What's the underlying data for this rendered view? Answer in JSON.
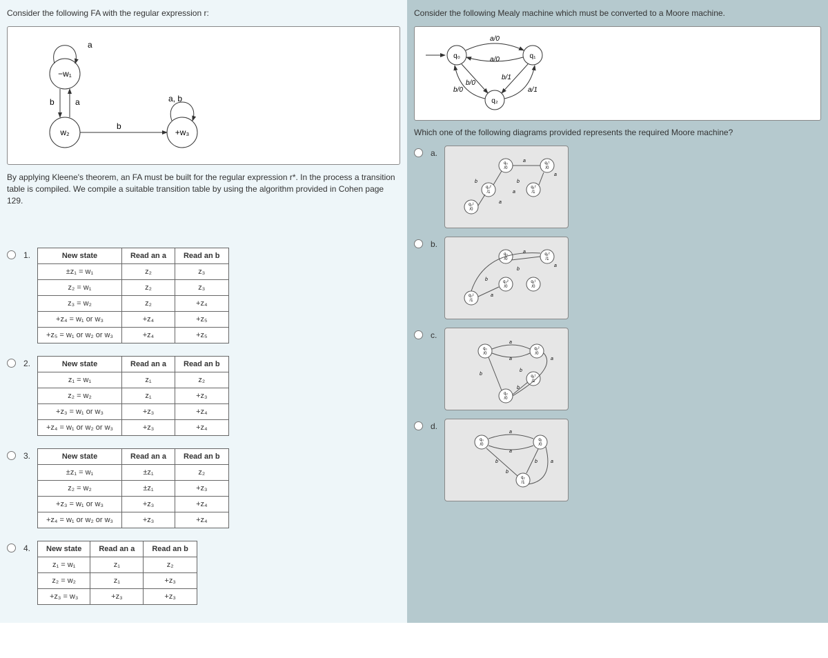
{
  "left": {
    "title": "Consider the following FA with the regular expression r:",
    "fa": {
      "w1": "−w₁",
      "w2": "w₂",
      "w3": "+w₃",
      "a": "a",
      "b": "b",
      "ab": "a, b"
    },
    "body": "By applying Kleene's theorem, an FA must be built for the regular expression r*. In the process a transition table is compiled. We compile a suitable transition table by using the algorithm provided in Cohen page 129.",
    "headers": {
      "c0": "New state",
      "c1": "Read an a",
      "c2": "Read an b"
    },
    "opts": {
      "1": [
        [
          "±z₁ = w₁",
          "z₂",
          "z₃"
        ],
        [
          "z₂  = w₁",
          "z₂",
          "z₃"
        ],
        [
          "z₃  = w₂",
          "z₂",
          "+z₄"
        ],
        [
          "+z₄ = w₁ or w₃",
          "+z₄",
          "+z₅"
        ],
        [
          "+z₅ = w₁ or w₂ or w₃",
          "+z₄",
          "+z₅"
        ]
      ],
      "2": [
        [
          "z₁  = w₁",
          "z₁",
          "z₂"
        ],
        [
          "z₂  = w₂",
          "z₁",
          "+z₃"
        ],
        [
          "+z₃ = w₁ or w₃",
          "+z₃",
          "+z₄"
        ],
        [
          "+z₄ = w₁ or w₂ or w₃",
          "+z₃",
          "+z₄"
        ]
      ],
      "3": [
        [
          "±z₁ = w₁",
          "±z₁",
          "z₂"
        ],
        [
          "z₂  = w₂",
          "±z₁",
          "+z₃"
        ],
        [
          "+z₃ = w₁ or w₃",
          "+z₃",
          "+z₄"
        ],
        [
          "+z₄ = w₁ or w₂ or w₃",
          "+z₃",
          "+z₄"
        ]
      ],
      "4": [
        [
          "z₁  = w₁",
          "z₁",
          "z₂"
        ],
        [
          "z₂  = w₂",
          "z₁",
          "+z₃"
        ],
        [
          "+z₃ = w₃",
          "+z₃",
          "+z₃"
        ]
      ]
    },
    "nums": {
      "1": "1.",
      "2": "2.",
      "3": "3.",
      "4": "4."
    }
  },
  "right": {
    "title": "Consider the following Mealy machine which must be converted to a Moore machine.",
    "question": "Which one of the following diagrams provided represents the required Moore machine?",
    "labels": {
      "a": "a.",
      "b": "b.",
      "c": "c.",
      "d": "d."
    },
    "mealy": {
      "q0": "q₀",
      "q1": "q₁",
      "q2": "q₂",
      "a0": "a/0",
      "b0": "b/0",
      "b1": "b/1",
      "a1": "a/1"
    }
  }
}
